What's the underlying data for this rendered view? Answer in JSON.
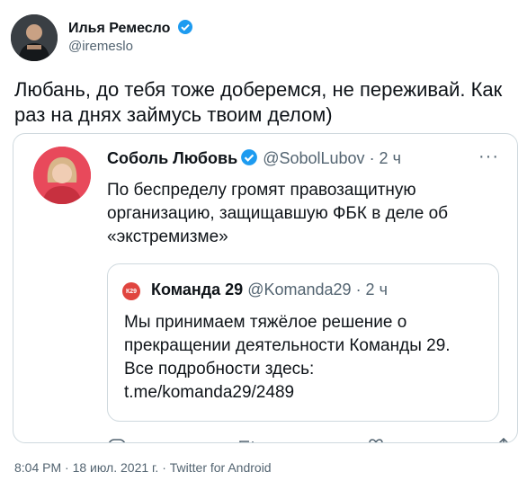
{
  "tweet": {
    "author_name": "Илья Ремесло",
    "author_handle": "@iremeslo",
    "text": "Любань, до тебя тоже доберемся, не переживай. Как раз на днях займусь твоим делом)",
    "timestamp": "8:04 PM · 18 июл. 2021 г. · Twitter for Android"
  },
  "quoted": {
    "author_name": "Соболь Любовь",
    "author_handle": "@SobolLubov",
    "time": "· 2 ч",
    "more_icon": "···",
    "text": "По беспределу громят правозащитную организацию, защищавшую ФБК в деле об «экстремизме»",
    "nested": {
      "logo_text": "К29",
      "author_name": "Команда 29",
      "author_handle": "@Komanda29",
      "time": "· 2 ч",
      "text": "Мы принимаем тяжёлое решение о прекращении деятельности Команды 29. Все подробности здесь: t.me/komanda29/2489"
    }
  },
  "colors": {
    "verified": "#1d9bf0",
    "muted": "#536471",
    "border": "#cfd9de",
    "accent_k29": "#e0453f"
  }
}
